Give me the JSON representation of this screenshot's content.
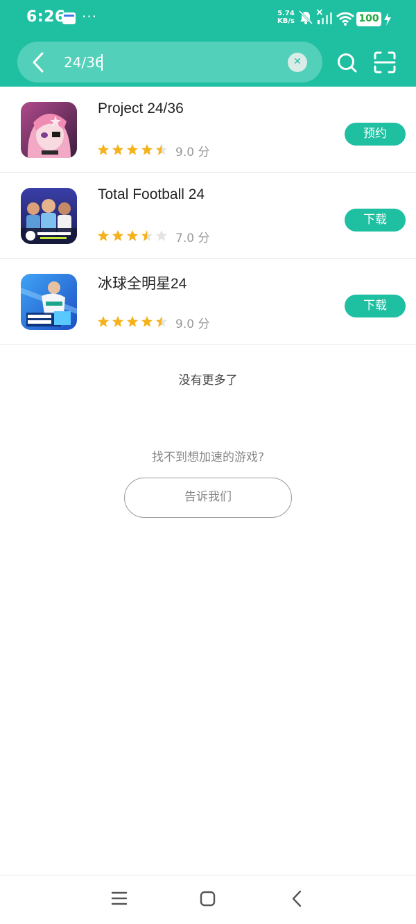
{
  "status_bar": {
    "time": "6:26",
    "network_speed_value": "5.74",
    "network_speed_unit": "KB/s",
    "battery": "100",
    "dots": "···"
  },
  "search": {
    "query": "24/36",
    "clear_icon": "close-icon"
  },
  "results": [
    {
      "title": "Project 24/36",
      "rating_stars": 4.5,
      "score": "9.0 分",
      "action": "预约"
    },
    {
      "title": "Total Football 24",
      "rating_stars": 3.5,
      "score": "7.0 分",
      "action": "下载"
    },
    {
      "title": "冰球全明星24",
      "rating_stars": 4.5,
      "score": "9.0 分",
      "action": "下载"
    }
  ],
  "footer": {
    "no_more": "没有更多了",
    "hint": "找不到想加速的游戏?",
    "tell_us": "告诉我们"
  },
  "colors": {
    "accent": "#1fbfa1",
    "star": "#f5b21b",
    "star_empty": "#e3e3e3"
  }
}
